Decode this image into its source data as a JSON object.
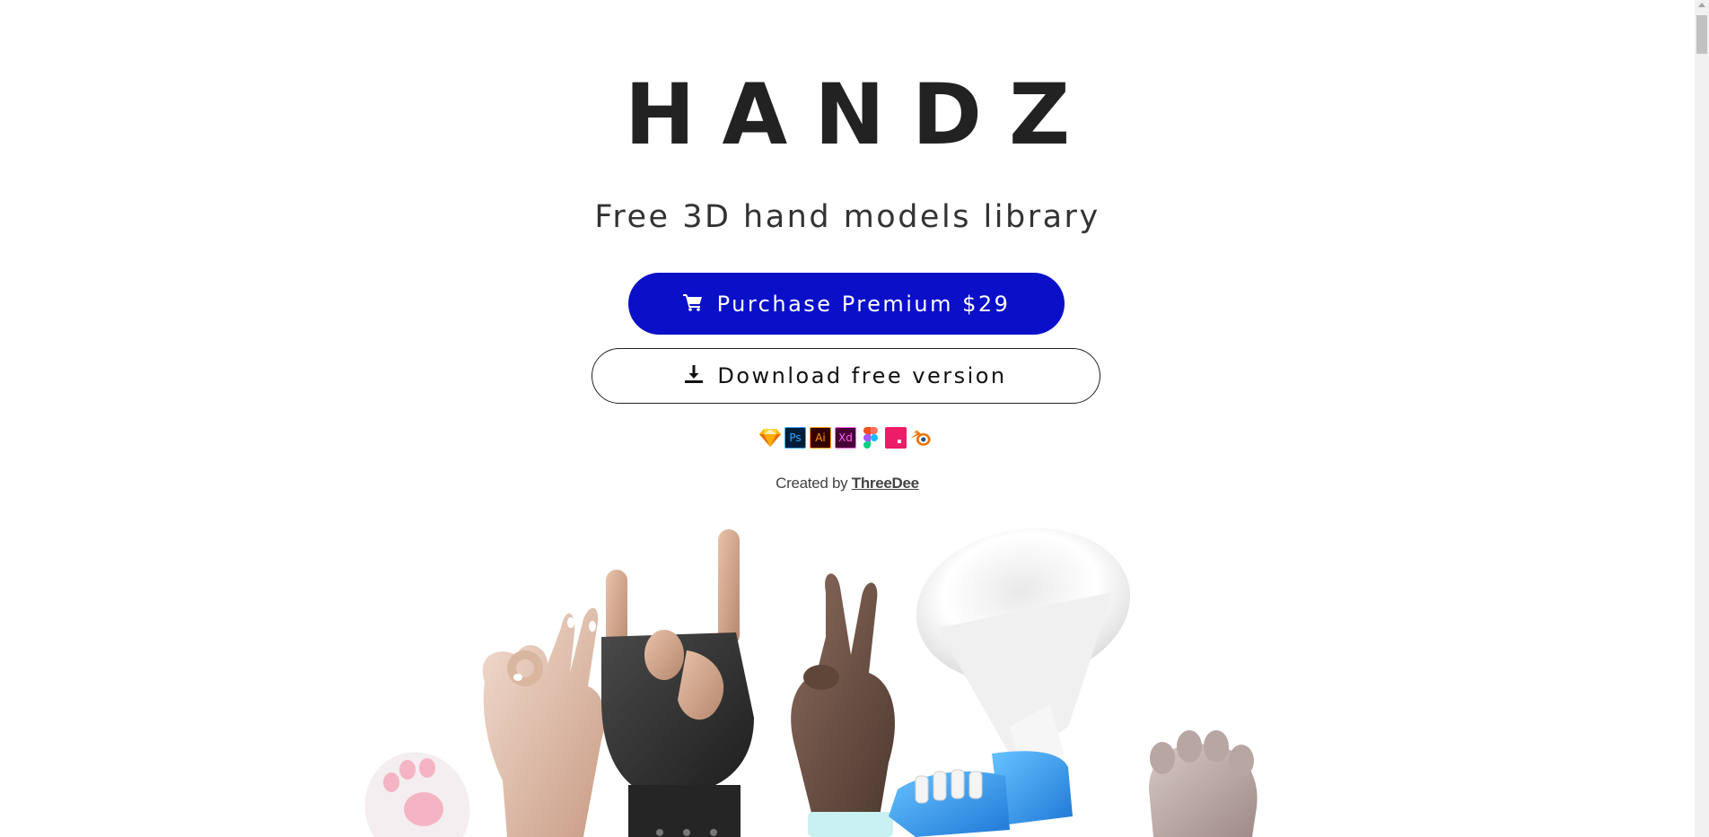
{
  "logo": "HANDZ",
  "tagline": "Free 3D hand models library",
  "buttons": {
    "premium_label": "Purchase Premium $29",
    "free_label": "Download free version"
  },
  "app_icons": [
    {
      "name": "sketch-icon",
      "text": "",
      "bg": "#ffffff",
      "fg": "#f7b500"
    },
    {
      "name": "photoshop-icon",
      "text": "Ps",
      "bg": "#001e36",
      "fg": "#31a8ff"
    },
    {
      "name": "illustrator-icon",
      "text": "Ai",
      "bg": "#330000",
      "fg": "#ff9a00"
    },
    {
      "name": "xd-icon",
      "text": "Xd",
      "bg": "#470137",
      "fg": "#ff61f6"
    },
    {
      "name": "figma-icon",
      "text": "",
      "bg": "#ffffff",
      "fg": "#f24e1e"
    },
    {
      "name": "invision-icon",
      "text": "",
      "bg": "#ec1c68",
      "fg": "#ffffff"
    },
    {
      "name": "blender-icon",
      "text": "",
      "bg": "#ffffff",
      "fg": "#ea7600"
    }
  ],
  "credit": {
    "prefix": "Created by",
    "author": "ThreeDee"
  },
  "colors": {
    "accent": "#0a0fc8",
    "text": "#222222"
  }
}
